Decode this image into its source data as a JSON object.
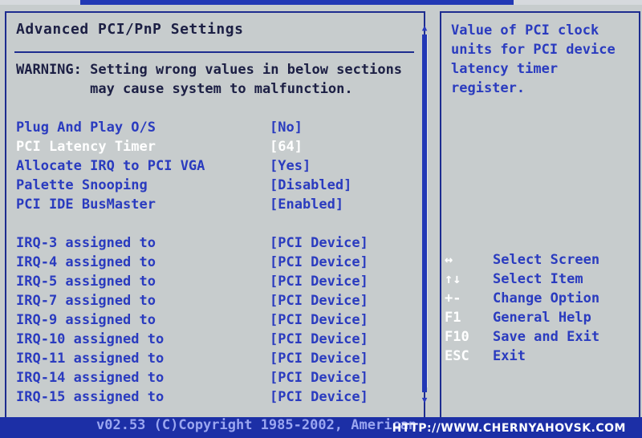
{
  "app": {
    "title": "Advanced PCI/PnP Settings",
    "warning_line1": "WARNING: Setting wrong values in below sections",
    "warning_line2": "         may cause system to malfunction."
  },
  "settings": [
    {
      "label": "Plug And Play O/S",
      "value": "[No]",
      "selected": false
    },
    {
      "label": "PCI Latency Timer",
      "value": "[64]",
      "selected": true
    },
    {
      "label": "Allocate IRQ to PCI VGA",
      "value": "[Yes]",
      "selected": false
    },
    {
      "label": "Palette Snooping",
      "value": "[Disabled]",
      "selected": false
    },
    {
      "label": "PCI IDE BusMaster",
      "value": "[Enabled]",
      "selected": false
    }
  ],
  "irqs": [
    {
      "label": "IRQ-3 assigned to",
      "value": "[PCI Device]"
    },
    {
      "label": "IRQ-4 assigned to",
      "value": "[PCI Device]"
    },
    {
      "label": "IRQ-5 assigned to",
      "value": "[PCI Device]"
    },
    {
      "label": "IRQ-7 assigned to",
      "value": "[PCI Device]"
    },
    {
      "label": "IRQ-9 assigned to",
      "value": "[PCI Device]"
    },
    {
      "label": "IRQ-10 assigned to",
      "value": "[PCI Device]"
    },
    {
      "label": "IRQ-11 assigned to",
      "value": "[PCI Device]"
    },
    {
      "label": "IRQ-14 assigned to",
      "value": "[PCI Device]"
    },
    {
      "label": "IRQ-15 assigned to",
      "value": "[PCI Device]"
    }
  ],
  "help": {
    "text": "Value of PCI clock\nunits for PCI device\nlatency timer\nregister."
  },
  "keys": [
    {
      "key": "↔",
      "desc": "Select Screen",
      "icon": "left-right-arrow-icon"
    },
    {
      "key": "↑↓",
      "desc": "Select Item",
      "icon": "up-down-arrow-icon"
    },
    {
      "key": "+-",
      "desc": "Change Option",
      "icon": "plus-minus-icon"
    },
    {
      "key": "F1",
      "desc": "General Help",
      "icon": "f1-key"
    },
    {
      "key": "F10",
      "desc": "Save and Exit",
      "icon": "f10-key"
    },
    {
      "key": "ESC",
      "desc": "Exit",
      "icon": "esc-key"
    }
  ],
  "footer": {
    "copyright": "v02.53 (C)Copyright 1985-2002, American",
    "watermark": "HTTP://WWW.CHERNYAHOVSK.COM"
  },
  "colors": {
    "background": "#c7cccd",
    "blue_text": "#2a3bbf",
    "dark_text": "#1c1f44",
    "frame": "#1d2c8f",
    "selected_text": "#ffffff",
    "footer_bg": "#1c2fa6"
  }
}
